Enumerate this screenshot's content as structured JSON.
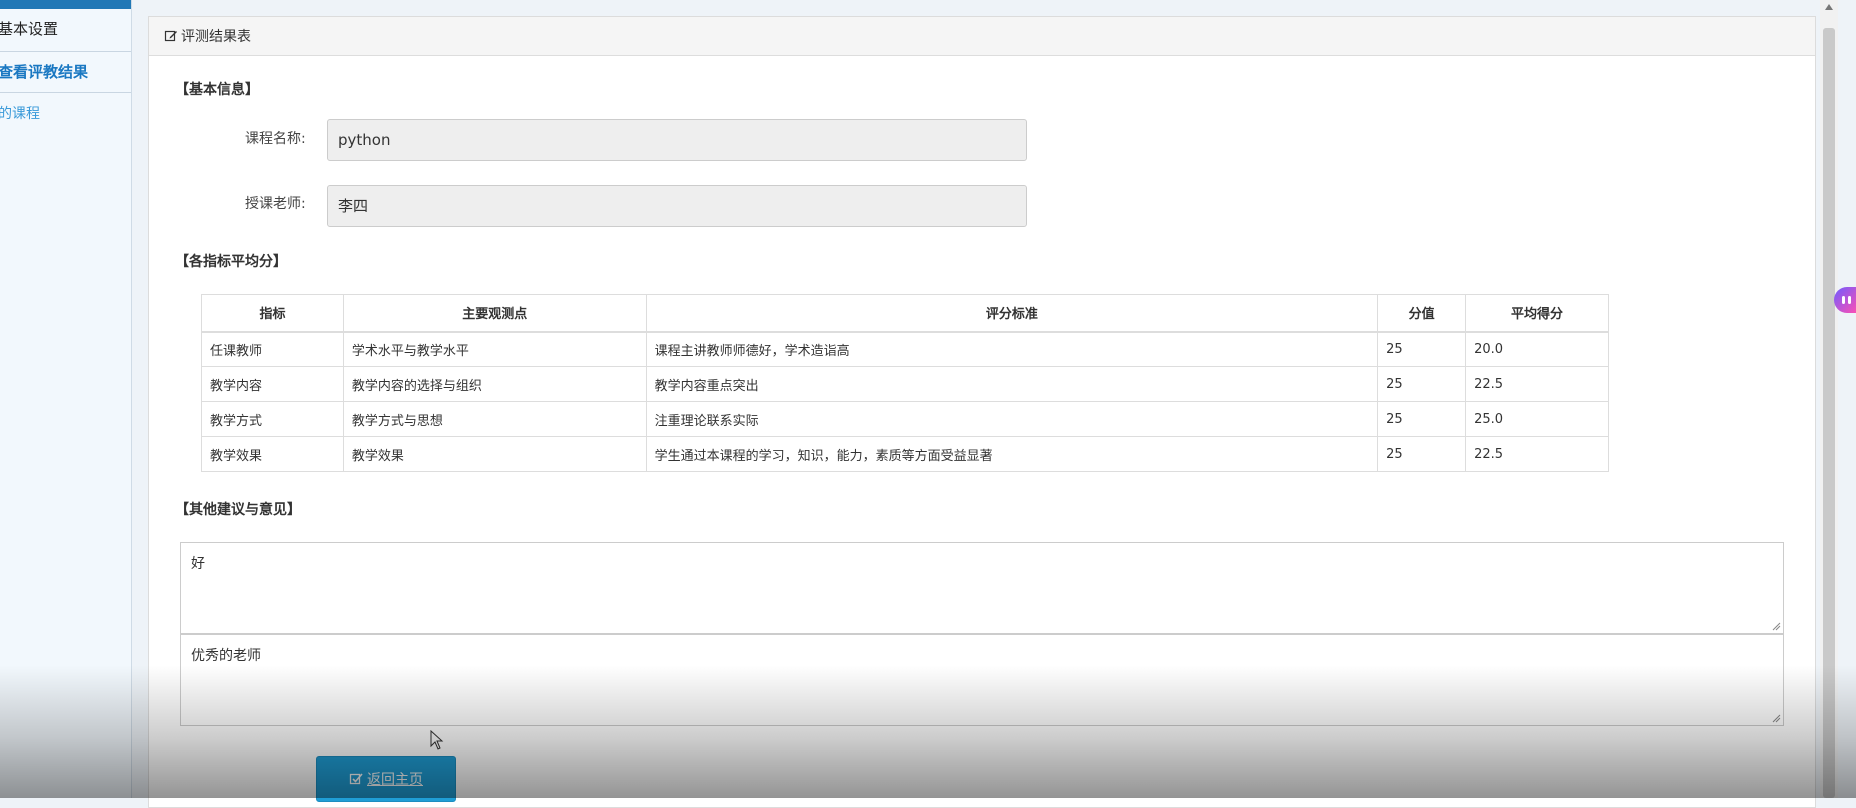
{
  "sidebar": {
    "header": "基本设置",
    "active_item": "查看评教结果",
    "link_item": "的课程"
  },
  "panel": {
    "title": "评测结果表"
  },
  "basic_info": {
    "section_title": "【基本信息】",
    "course_label": "课程名称:",
    "course_value": "python",
    "teacher_label": "授课老师:",
    "teacher_value": "李四"
  },
  "scores": {
    "section_title": "【各指标平均分】",
    "headers": [
      "指标",
      "主要观测点",
      "评分标准",
      "分值",
      "平均得分"
    ],
    "rows": [
      [
        "任课教师",
        "学术水平与教学水平",
        "课程主讲教师师德好，学术造诣高",
        "25",
        "20.0"
      ],
      [
        "教学内容",
        "教学内容的选择与组织",
        "教学内容重点突出",
        "25",
        "22.5"
      ],
      [
        "教学方式",
        "教学方式与思想",
        "注重理论联系实际",
        "25",
        "25.0"
      ],
      [
        "教学效果",
        "教学效果",
        "学生通过本课程的学习，知识，能力，素质等方面受益显著",
        "25",
        "22.5"
      ]
    ]
  },
  "comments": {
    "section_title": "【其他建议与意见】",
    "comment_1": "好",
    "comment_2": "优秀的老师"
  },
  "actions": {
    "return_label": "返回主页"
  },
  "icons": {
    "panel_title_icon": "edit-icon",
    "return_icon": "check-square-icon"
  },
  "colors": {
    "accent": "#1f9ed6",
    "sidebar_active": "#1a78c2"
  }
}
